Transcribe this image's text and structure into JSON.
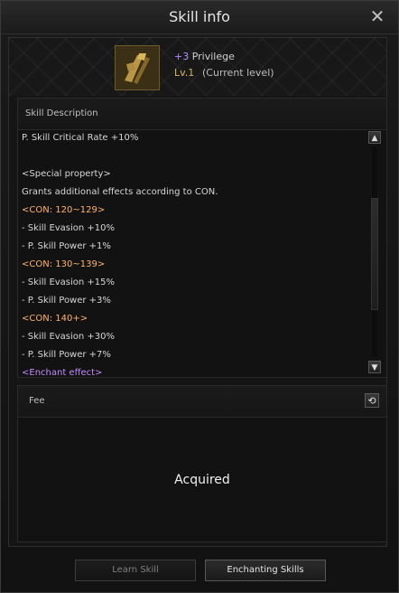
{
  "window": {
    "title": "Skill info"
  },
  "skill": {
    "enhance": "+3",
    "name": "Privilege",
    "level": "Lv.1",
    "level_note": "(Current level)",
    "icon": "sword-knight-icon"
  },
  "description": {
    "header": "Skill Description",
    "lines": [
      {
        "text": "P. Skill Critical Rate +10%",
        "style": "white"
      },
      {
        "text": "",
        "style": "white"
      },
      {
        "text": "<Special property>",
        "style": "white"
      },
      {
        "text": "Grants additional effects according to CON.",
        "style": "white"
      },
      {
        "text": "<CON: 120~129>",
        "style": "gold"
      },
      {
        "text": "- Skill Evasion +10%",
        "style": "white"
      },
      {
        "text": "- P. Skill Power +1%",
        "style": "white"
      },
      {
        "text": "<CON: 130~139>",
        "style": "gold"
      },
      {
        "text": "- Skill Evasion +15%",
        "style": "white"
      },
      {
        "text": "- P. Skill Power +3%",
        "style": "white"
      },
      {
        "text": "<CON: 140+>",
        "style": "gold"
      },
      {
        "text": "- Skill Evasion +30%",
        "style": "white"
      },
      {
        "text": "- P. Skill Power +7%",
        "style": "white"
      },
      {
        "text": "<Enchant effect>",
        "style": "purple"
      }
    ]
  },
  "fee": {
    "header": "Fee",
    "status": "Acquired"
  },
  "buttons": {
    "learn": "Learn Skill",
    "enchant": "Enchanting Skills"
  },
  "colors": {
    "accent_purple": "#c28bff",
    "accent_gold": "#ffb36b"
  }
}
